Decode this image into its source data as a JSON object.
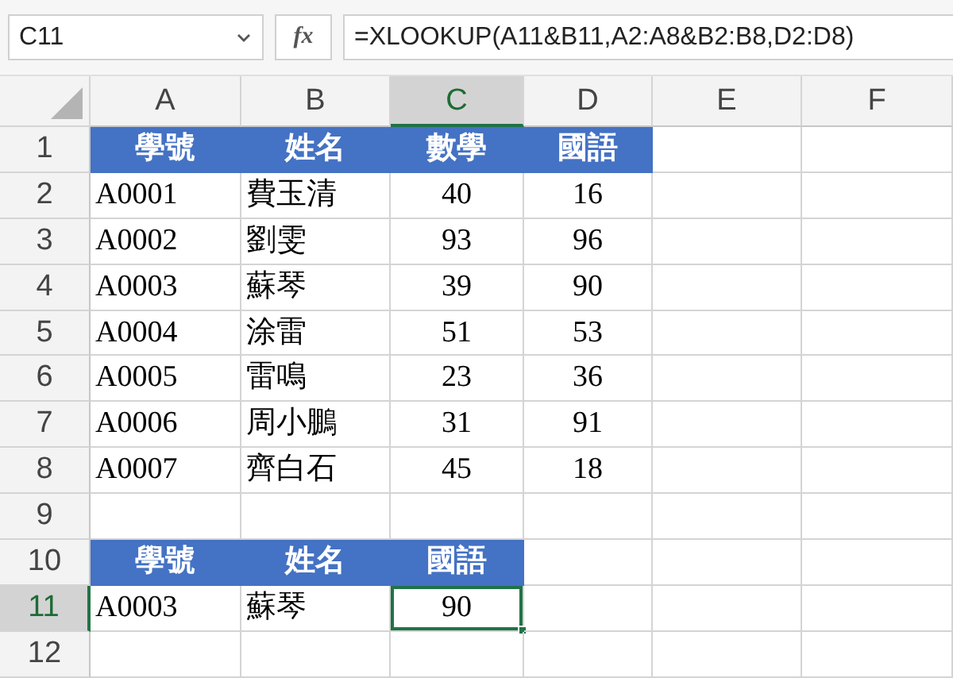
{
  "name_box": {
    "value": "C11"
  },
  "function_button": "fx",
  "formula": {
    "value": "=XLOOKUP(A11&B11,A2:A8&B2:B8,D2:D8)"
  },
  "columns": [
    {
      "label": "A",
      "selected": false
    },
    {
      "label": "B",
      "selected": false
    },
    {
      "label": "C",
      "selected": true
    },
    {
      "label": "D",
      "selected": false
    },
    {
      "label": "E",
      "selected": false
    },
    {
      "label": "F",
      "selected": false
    }
  ],
  "rows": [
    {
      "label": "1",
      "selected": false,
      "cells": [
        {
          "kind": "header",
          "text": "學號",
          "selected": false
        },
        {
          "kind": "header",
          "text": "姓名",
          "selected": false
        },
        {
          "kind": "header",
          "text": "數學",
          "selected": false
        },
        {
          "kind": "header",
          "text": "國語",
          "selected": false
        },
        {
          "kind": "empty",
          "selected": false
        },
        {
          "kind": "empty",
          "selected": false
        }
      ]
    },
    {
      "label": "2",
      "selected": false,
      "cells": [
        {
          "kind": "text",
          "text": "A0001",
          "selected": false
        },
        {
          "kind": "text",
          "text": "費玉清",
          "selected": false
        },
        {
          "kind": "number",
          "text": "40",
          "selected": false
        },
        {
          "kind": "number",
          "text": "16",
          "selected": false
        },
        {
          "kind": "empty",
          "selected": false
        },
        {
          "kind": "empty",
          "selected": false
        }
      ]
    },
    {
      "label": "3",
      "selected": false,
      "cells": [
        {
          "kind": "text",
          "text": "A0002",
          "selected": false
        },
        {
          "kind": "text",
          "text": "劉雯",
          "selected": false
        },
        {
          "kind": "number",
          "text": "93",
          "selected": false
        },
        {
          "kind": "number",
          "text": "96",
          "selected": false
        },
        {
          "kind": "empty",
          "selected": false
        },
        {
          "kind": "empty",
          "selected": false
        }
      ]
    },
    {
      "label": "4",
      "selected": false,
      "cells": [
        {
          "kind": "text",
          "text": "A0003",
          "selected": false
        },
        {
          "kind": "text",
          "text": "蘇琴",
          "selected": false
        },
        {
          "kind": "number",
          "text": "39",
          "selected": false
        },
        {
          "kind": "number",
          "text": "90",
          "selected": false
        },
        {
          "kind": "empty",
          "selected": false
        },
        {
          "kind": "empty",
          "selected": false
        }
      ]
    },
    {
      "label": "5",
      "selected": false,
      "cells": [
        {
          "kind": "text",
          "text": "A0004",
          "selected": false
        },
        {
          "kind": "text",
          "text": "涂雷",
          "selected": false
        },
        {
          "kind": "number",
          "text": "51",
          "selected": false
        },
        {
          "kind": "number",
          "text": "53",
          "selected": false
        },
        {
          "kind": "empty",
          "selected": false
        },
        {
          "kind": "empty",
          "selected": false
        }
      ]
    },
    {
      "label": "6",
      "selected": false,
      "cells": [
        {
          "kind": "text",
          "text": "A0005",
          "selected": false
        },
        {
          "kind": "text",
          "text": "雷鳴",
          "selected": false
        },
        {
          "kind": "number",
          "text": "23",
          "selected": false
        },
        {
          "kind": "number",
          "text": "36",
          "selected": false
        },
        {
          "kind": "empty",
          "selected": false
        },
        {
          "kind": "empty",
          "selected": false
        }
      ]
    },
    {
      "label": "7",
      "selected": false,
      "cells": [
        {
          "kind": "text",
          "text": "A0006",
          "selected": false
        },
        {
          "kind": "text",
          "text": "周小鵬",
          "selected": false
        },
        {
          "kind": "number",
          "text": "31",
          "selected": false
        },
        {
          "kind": "number",
          "text": "91",
          "selected": false
        },
        {
          "kind": "empty",
          "selected": false
        },
        {
          "kind": "empty",
          "selected": false
        }
      ]
    },
    {
      "label": "8",
      "selected": false,
      "cells": [
        {
          "kind": "text",
          "text": "A0007",
          "selected": false
        },
        {
          "kind": "text",
          "text": "齊白石",
          "selected": false
        },
        {
          "kind": "number",
          "text": "45",
          "selected": false
        },
        {
          "kind": "number",
          "text": "18",
          "selected": false
        },
        {
          "kind": "empty",
          "selected": false
        },
        {
          "kind": "empty",
          "selected": false
        }
      ]
    },
    {
      "label": "9",
      "selected": false,
      "cells": [
        {
          "kind": "empty",
          "selected": false
        },
        {
          "kind": "empty",
          "selected": false
        },
        {
          "kind": "empty",
          "selected": false
        },
        {
          "kind": "empty",
          "selected": false
        },
        {
          "kind": "empty",
          "selected": false
        },
        {
          "kind": "empty",
          "selected": false
        }
      ]
    },
    {
      "label": "10",
      "selected": false,
      "cells": [
        {
          "kind": "header",
          "text": "學號",
          "selected": false
        },
        {
          "kind": "header",
          "text": "姓名",
          "selected": false
        },
        {
          "kind": "header",
          "text": "國語",
          "selected": false
        },
        {
          "kind": "empty",
          "selected": false
        },
        {
          "kind": "empty",
          "selected": false
        },
        {
          "kind": "empty",
          "selected": false
        }
      ]
    },
    {
      "label": "11",
      "selected": true,
      "cells": [
        {
          "kind": "text",
          "text": "A0003",
          "selected": false
        },
        {
          "kind": "text",
          "text": "蘇琴",
          "selected": false
        },
        {
          "kind": "number",
          "text": "90",
          "selected": true
        },
        {
          "kind": "empty",
          "selected": false
        },
        {
          "kind": "empty",
          "selected": false
        },
        {
          "kind": "empty",
          "selected": false
        }
      ]
    },
    {
      "label": "12",
      "selected": false,
      "cells": [
        {
          "kind": "empty",
          "selected": false
        },
        {
          "kind": "empty",
          "selected": false
        },
        {
          "kind": "empty",
          "selected": false
        },
        {
          "kind": "empty",
          "selected": false
        },
        {
          "kind": "empty",
          "selected": false
        },
        {
          "kind": "empty",
          "selected": false
        }
      ]
    }
  ]
}
